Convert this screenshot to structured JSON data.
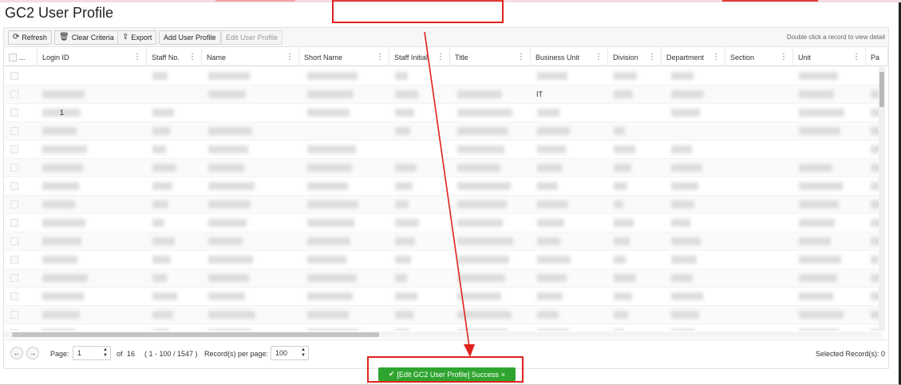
{
  "page": {
    "title": "GC2 User Profile"
  },
  "toolbar": {
    "refresh_label": "Refresh",
    "clear_label": "Clear Criteria",
    "export_label": "Export",
    "add_label": "Add User Profile",
    "edit_label": "Edit User Profile",
    "hint": "Double click a record to view detail"
  },
  "icons": {
    "refresh": "refresh-icon",
    "clear": "trash-icon",
    "export": "export-icon",
    "column_menu": "kebab-icon",
    "success": "check-circle-icon",
    "close": "close-icon"
  },
  "columns": [
    {
      "label": "..."
    },
    {
      "label": "Login ID"
    },
    {
      "label": "Staff No."
    },
    {
      "label": "Name"
    },
    {
      "label": "Short Name"
    },
    {
      "label": "Staff Initial"
    },
    {
      "label": "Title"
    },
    {
      "label": "Business Unit"
    },
    {
      "label": "Division"
    },
    {
      "label": "Department"
    },
    {
      "label": "Section"
    },
    {
      "label": "Unit"
    },
    {
      "label": "Pa"
    }
  ],
  "visible_cells": {
    "row2_business_unit": "IT",
    "row3_login_suffix": "1"
  },
  "pager": {
    "page_label": "Page:",
    "page_value": "1",
    "of_label": "of",
    "total_pages": "16",
    "range": "( 1 - 100 / 1547 )",
    "per_page_label": "Record(s) per page:",
    "per_page_value": "100",
    "selected": "Selected Record(s): 0"
  },
  "toast": {
    "message": "[Edit GC2 User Profile] Success",
    "close": "×"
  },
  "colors": {
    "annotation_red": "#e0221c",
    "toast_green": "#2fa52f"
  }
}
